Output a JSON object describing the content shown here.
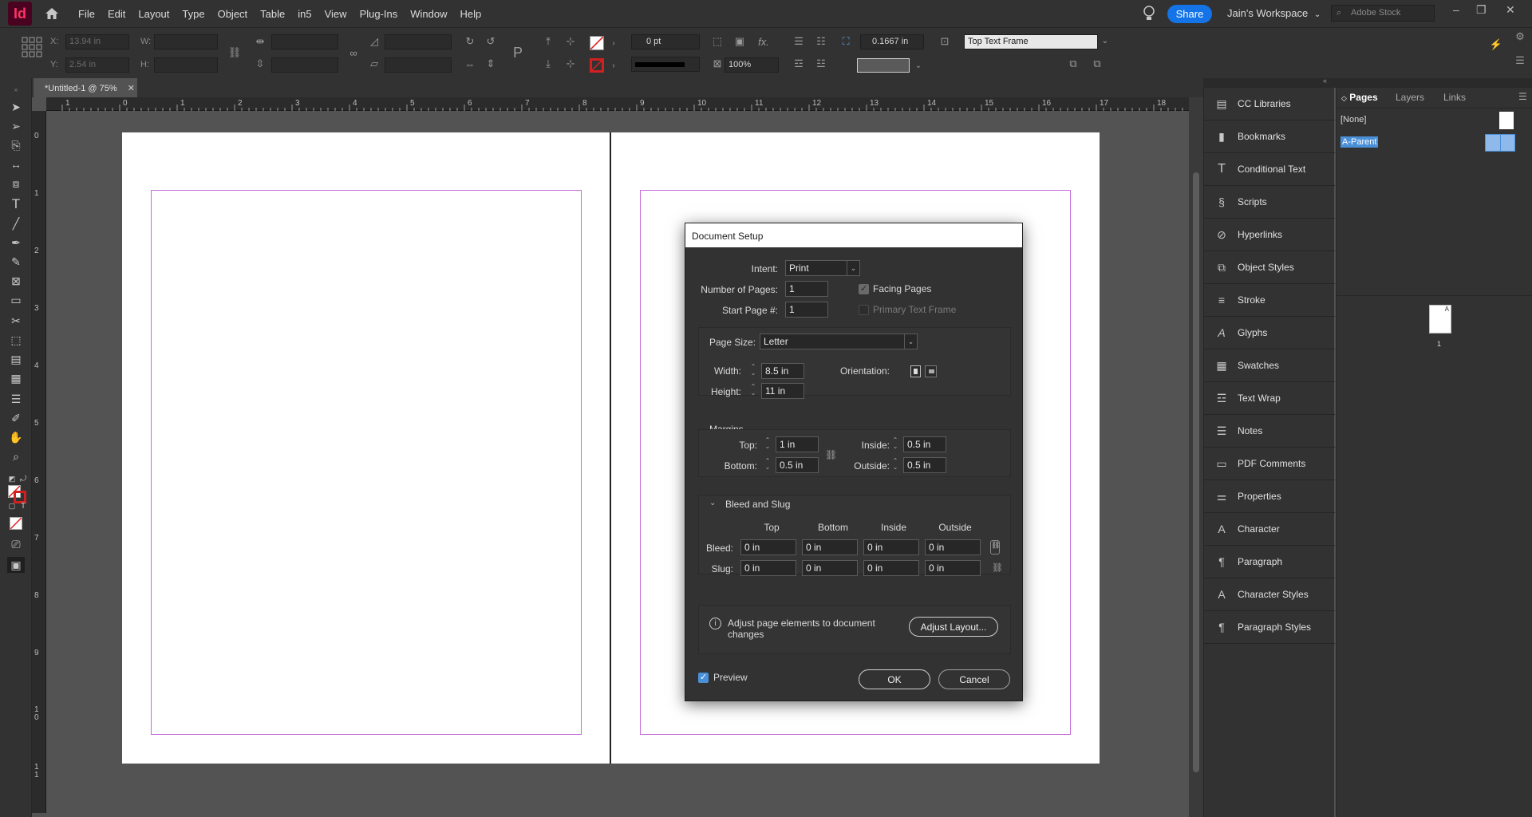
{
  "app": {
    "logo_text": "Id"
  },
  "menu": [
    "File",
    "Edit",
    "Layout",
    "Type",
    "Object",
    "Table",
    "in5",
    "View",
    "Plug-Ins",
    "Window",
    "Help"
  ],
  "header": {
    "share_label": "Share",
    "workspace_label": "Jain's Workspace",
    "stock_placeholder": "Adobe Stock"
  },
  "control": {
    "x_label": "X:",
    "x_value": "13.94 in",
    "y_label": "Y:",
    "y_value": "2.54 in",
    "w_label": "W:",
    "h_label": "H:",
    "stroke_weight": "0 pt",
    "scale_percent": "100%",
    "frame_offset": "0.1667 in",
    "frame_style": "Top Text Frame"
  },
  "document": {
    "tab_title": "*Untitled-1 @ 75%"
  },
  "ruler": {
    "h_labels": [
      "1",
      "0",
      "1",
      "2",
      "3",
      "4",
      "5",
      "6",
      "7",
      "8",
      "9",
      "10",
      "11",
      "12",
      "13",
      "14",
      "15",
      "16",
      "17",
      "18"
    ],
    "v_labels": [
      "0",
      "1",
      "2",
      "3",
      "4",
      "5",
      "6",
      "7",
      "8",
      "9",
      "1\n0",
      "1\n1"
    ]
  },
  "dialog": {
    "title": "Document Setup",
    "intent_label": "Intent:",
    "intent_value": "Print",
    "num_pages_label": "Number of Pages:",
    "num_pages_value": "1",
    "start_page_label": "Start Page #:",
    "start_page_value": "1",
    "facing_pages_label": "Facing Pages",
    "facing_pages_checked": true,
    "primary_text_frame_label": "Primary Text Frame",
    "primary_text_frame_checked": false,
    "page_size_label": "Page Size:",
    "page_size_value": "Letter",
    "width_label": "Width:",
    "width_value": "8.5 in",
    "height_label": "Height:",
    "height_value": "11 in",
    "orientation_label": "Orientation:",
    "margins_heading": "Margins",
    "top_label": "Top:",
    "top_value": "1 in",
    "bottom_label": "Bottom:",
    "bottom_value": "0.5 in",
    "inside_label": "Inside:",
    "inside_value": "0.5 in",
    "outside_label": "Outside:",
    "outside_value": "0.5 in",
    "bleed_slug_heading": "Bleed and Slug",
    "bs_columns": [
      "Top",
      "Bottom",
      "Inside",
      "Outside"
    ],
    "bleed_label": "Bleed:",
    "bleed_values": [
      "0 in",
      "0 in",
      "0 in",
      "0 in"
    ],
    "slug_label": "Slug:",
    "slug_values": [
      "0 in",
      "0 in",
      "0 in",
      "0 in"
    ],
    "adjust_text": "Adjust page elements to document changes",
    "adjust_button": "Adjust Layout...",
    "preview_label": "Preview",
    "preview_checked": true,
    "ok_label": "OK",
    "cancel_label": "Cancel"
  },
  "panels": [
    {
      "label": "CC Libraries",
      "icon": "cc-libraries-icon"
    },
    {
      "label": "Bookmarks",
      "icon": "bookmark-icon"
    },
    {
      "label": "Conditional Text",
      "icon": "conditional-text-icon"
    },
    {
      "label": "Scripts",
      "icon": "scripts-icon"
    },
    {
      "label": "Hyperlinks",
      "icon": "hyperlinks-icon"
    },
    {
      "label": "Object Styles",
      "icon": "object-styles-icon"
    },
    {
      "label": "Stroke",
      "icon": "stroke-icon"
    },
    {
      "label": "Glyphs",
      "icon": "glyphs-icon"
    },
    {
      "label": "Swatches",
      "icon": "swatches-icon"
    },
    {
      "label": "Text Wrap",
      "icon": "text-wrap-icon"
    },
    {
      "label": "Notes",
      "icon": "notes-icon"
    },
    {
      "label": "PDF Comments",
      "icon": "pdf-comments-icon"
    },
    {
      "label": "Properties",
      "icon": "properties-icon"
    },
    {
      "label": "Character",
      "icon": "character-icon"
    },
    {
      "label": "Paragraph",
      "icon": "paragraph-icon"
    },
    {
      "label": "Character Styles",
      "icon": "character-styles-icon"
    },
    {
      "label": "Paragraph Styles",
      "icon": "paragraph-styles-icon"
    }
  ],
  "pages_panel": {
    "tabs": [
      "Pages",
      "Layers",
      "Links"
    ],
    "none_label": "[None]",
    "parent_label": "A-Parent",
    "thumb_marker": "A",
    "page_number": "1"
  },
  "colors": {
    "accent": "#1473e6",
    "guide": "#c56bd8",
    "logo_bg": "#49021f",
    "logo_fg": "#ff3366",
    "selection": "#4a90d9"
  }
}
